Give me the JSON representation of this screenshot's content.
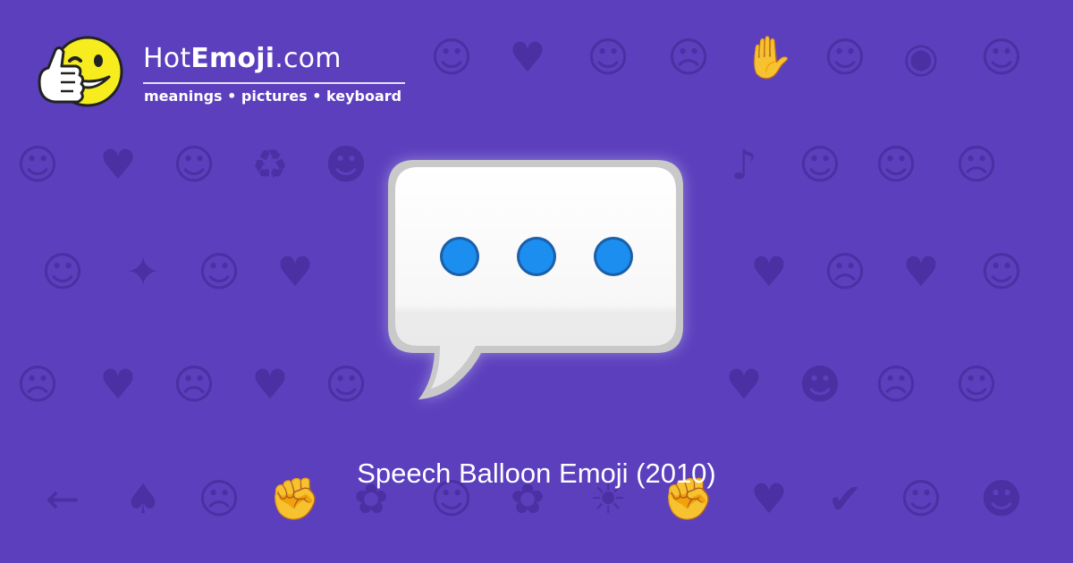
{
  "site": {
    "name_prefix": "Hot",
    "name_bold": "Emoji",
    "name_suffix": ".com",
    "tagline": "meanings • pictures • keyboard"
  },
  "emoji": {
    "caption": "Speech Balloon Emoji (2010)",
    "icon": "speech-balloon-icon"
  },
  "background_icons": [
    "☺",
    "♥",
    "☺",
    "☹",
    "✋",
    "☺",
    "◉",
    "☺",
    "☺",
    "♥",
    "☺",
    "♻",
    "☻",
    "♪",
    "☺",
    "☺",
    "☹",
    "☺",
    "✦",
    "☺",
    "♥",
    "♥",
    "☹",
    "♥",
    "☺",
    "☹",
    "♥",
    "☹",
    "♥",
    "☺",
    "♥",
    "☻",
    "☹",
    "☺",
    "←",
    "♠",
    "☹",
    "✊",
    "✿",
    "☺",
    "✿",
    "☀",
    "✊",
    "♥",
    "✔",
    "☺",
    "☻",
    "☺",
    "✋",
    "☺",
    "☺",
    "☺",
    "☺",
    "♥",
    "☺",
    "☺"
  ],
  "colors": {
    "background": "#5b3fbd",
    "pattern": "#4a30a2",
    "dots": "#1b8ef0",
    "logo_yellow": "#f7ec1e"
  }
}
